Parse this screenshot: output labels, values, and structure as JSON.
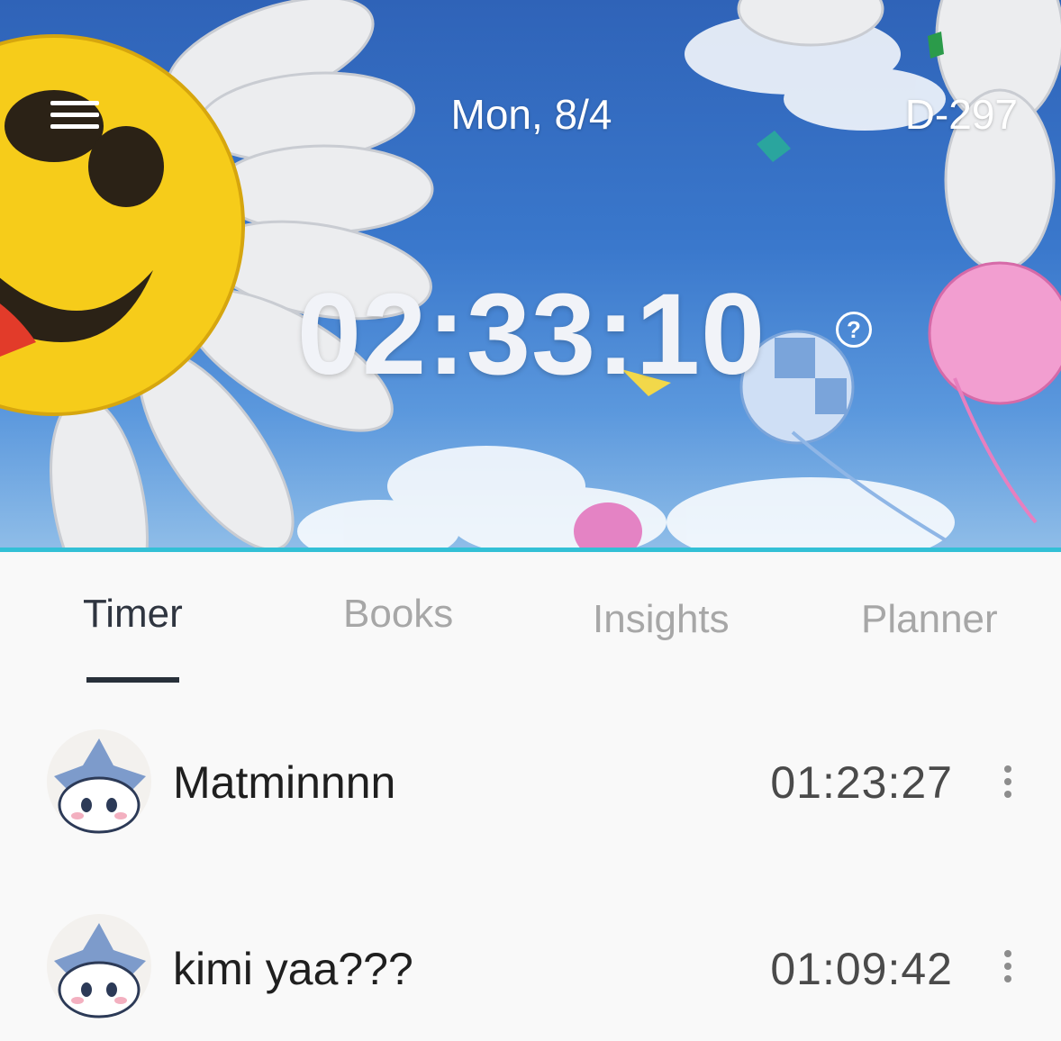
{
  "header": {
    "date": "Mon, 8/4",
    "dday": "D-297",
    "timer": "02:33:10",
    "help_symbol": "?"
  },
  "tabs": [
    {
      "label": "Timer",
      "active": true
    },
    {
      "label": "Books",
      "active": false
    },
    {
      "label": "Insights",
      "active": false
    },
    {
      "label": "Planner",
      "active": false
    }
  ],
  "members": [
    {
      "name": "Matminnnn",
      "time": "01:23:27"
    },
    {
      "name": "kimi yaa???",
      "time": "01:09:42"
    }
  ],
  "icons": {
    "menu": "hamburger-menu-icon",
    "help": "question-circle-icon",
    "more": "vertical-dots-icon"
  },
  "colors": {
    "accent_line": "#33c0d6",
    "active_tab": "#2f3540",
    "inactive_tab": "#a7a7a7"
  }
}
